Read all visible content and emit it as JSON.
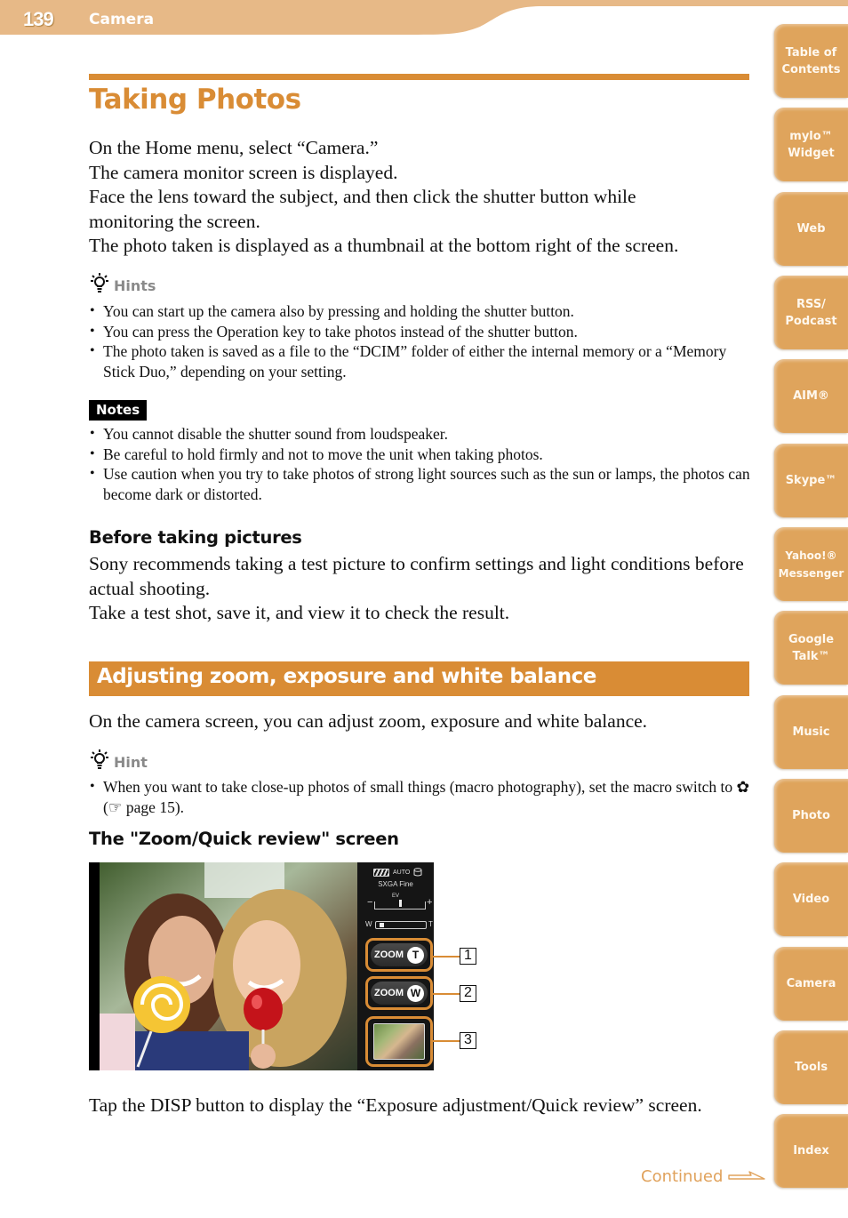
{
  "header": {
    "page_number": "139",
    "section": "Camera",
    "colors": {
      "band": "#e7b987",
      "accent": "#d98c35",
      "tab": "#dfa45c"
    }
  },
  "side_tabs": [
    {
      "label": "Table of\nContents"
    },
    {
      "label": "mylo™\nWidget"
    },
    {
      "label": "Web"
    },
    {
      "label": "RSS/\nPodcast"
    },
    {
      "label": "AIM®"
    },
    {
      "label": "Skype™"
    },
    {
      "label": "Yahoo!®\nMessenger"
    },
    {
      "label": "Google\nTalk™"
    },
    {
      "label": "Music"
    },
    {
      "label": "Photo"
    },
    {
      "label": "Video"
    },
    {
      "label": "Camera"
    },
    {
      "label": "Tools"
    },
    {
      "label": "Index"
    }
  ],
  "page": {
    "title": "Taking Photos",
    "intro": [
      "On the Home menu, select “Camera.”",
      "The camera monitor screen is displayed.",
      "Face the lens toward the subject, and then click the shutter button while monitoring the screen.",
      "The photo taken is displayed as a thumbnail at the bottom right of the screen."
    ],
    "hints": {
      "label": "Hints",
      "items": [
        "You can start up the camera also by pressing and holding the shutter button.",
        "You can press the Operation key to take photos instead of the shutter button.",
        "The photo taken is saved as a file to the “DCIM” folder of either the internal memory or a “Memory Stick Duo,” depending on your setting."
      ]
    },
    "notes": {
      "label": "Notes",
      "items": [
        "You cannot disable the shutter sound from loudspeaker.",
        "Be careful to hold firmly and not to move the unit when taking photos.",
        "Use caution when you try to take photos of strong light sources such as the sun or lamps, the photos can become dark or distorted."
      ]
    },
    "before": {
      "heading": "Before taking pictures",
      "lines": [
        "Sony recommends taking a test picture to confirm settings and light conditions before actual shooting.",
        "Take a test shot, save it, and view it to check the result."
      ]
    },
    "adjust": {
      "heading": "Adjusting zoom, exposure and white balance",
      "intro": "On the camera screen, you can adjust zoom, exposure and white balance.",
      "hint_label": "Hint",
      "hint_text_before": "When you want to take close-up photos of small things (macro photography), set the macro switch to ",
      "hint_macro_icon": "✿",
      "hint_ref_icon": "☞",
      "hint_text_after": " page 15)."
    },
    "zoom_screen": {
      "heading": "The \"Zoom/Quick review\" screen",
      "status_mode": "AUTO",
      "quality": "SXGA Fine",
      "ev_label": "EV",
      "ev_minus": "−",
      "ev_plus": "+",
      "zoom_w": "W",
      "zoom_t": "T",
      "ev_level_fraction": 0.5,
      "zoom_level_fraction": 0.05,
      "buttons": [
        {
          "label": "ZOOM",
          "badge": "T",
          "callout": "1"
        },
        {
          "label": "ZOOM",
          "badge": "W",
          "callout": "2"
        },
        {
          "label": "",
          "badge": "",
          "callout": "3"
        }
      ]
    },
    "closing": "Tap the DISP button to display the “Exposure adjustment/Quick review” screen.",
    "continued": "Continued"
  }
}
